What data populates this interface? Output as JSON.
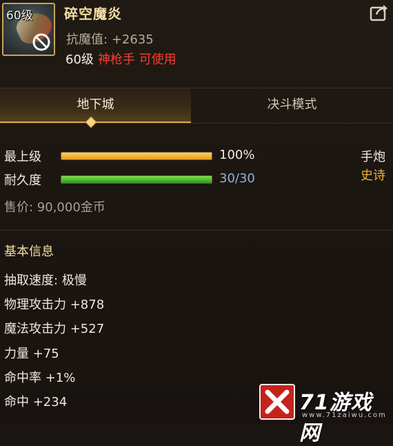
{
  "item": {
    "level_badge": "60级",
    "name": "碎空魔炎",
    "resist_label": "抗魔值:",
    "resist_value": "+2635",
    "req_level": "60级",
    "req_class": "神枪手 可使用"
  },
  "tabs": [
    {
      "label": "地下城",
      "active": true
    },
    {
      "label": "决斗模式",
      "active": false
    }
  ],
  "stats": {
    "upgrade": {
      "label": "最上级",
      "percent_text": "100%",
      "fill": 1.0,
      "color": "#f0b534"
    },
    "durability": {
      "label": "耐久度",
      "value_text": "30/30",
      "fill": 1.0,
      "color": "#54c233"
    },
    "weapon_type": "手炮",
    "rarity": "史诗",
    "rarity_color": "#e8b23a",
    "price": "售价: 90,000金币"
  },
  "basic_info": {
    "title": "基本信息",
    "attrs": [
      "抽取速度: 极慢",
      "物理攻击力 +878",
      "魔法攻击力 +527",
      "力量 +75",
      "命中率 +1%",
      "命中 +234"
    ]
  },
  "watermark": {
    "brand": "71游戏网",
    "url": "www.71zaiwu.com"
  },
  "icons": [
    "no-use-icon",
    "share-icon",
    "tab-diamond-icon",
    "watermark-logo-icon"
  ]
}
